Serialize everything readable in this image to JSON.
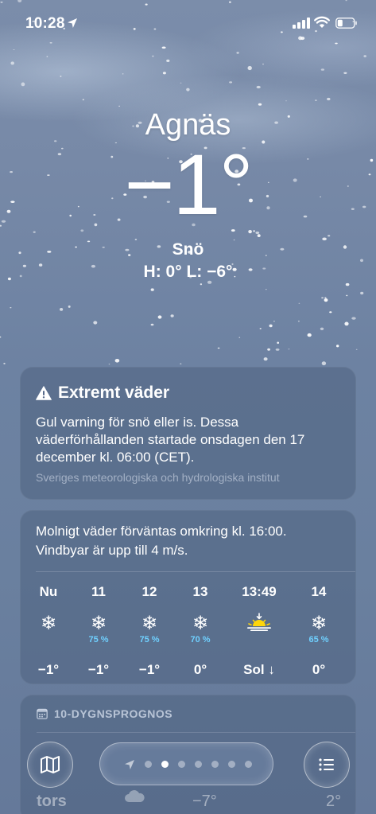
{
  "status_bar": {
    "time": "10:28",
    "icons": [
      "location-arrow-icon",
      "signal-icon",
      "wifi-icon",
      "battery-icon"
    ]
  },
  "header": {
    "city": "Agnäs",
    "temperature": "−1°",
    "condition": "Snö",
    "high_low": "H: 0°  L: −6°"
  },
  "alert": {
    "icon": "warning-icon",
    "title": "Extremt väder",
    "body": "Gul varning för snö eller is. Dessa väderförhållanden startade onsdagen den 17 december kl. 06:00 (CET).",
    "source": "Sveriges meteorologiska och hydrologiska institut"
  },
  "hourly": {
    "summary": "Molnigt väder förväntas omkring kl. 16:00. Vindbyar är upp till 4 m/s.",
    "hours": [
      {
        "label": "Nu",
        "icon": "snowflake-icon",
        "precip": "",
        "temp": "−1°"
      },
      {
        "label": "11",
        "icon": "snowflake-icon",
        "precip": "75 %",
        "temp": "−1°"
      },
      {
        "label": "12",
        "icon": "snowflake-icon",
        "precip": "75 %",
        "temp": "−1°"
      },
      {
        "label": "13",
        "icon": "snowflake-icon",
        "precip": "70 %",
        "temp": "0°"
      },
      {
        "label": "13:49",
        "icon": "sunset-icon",
        "precip": "",
        "temp": "Sol ↓"
      },
      {
        "label": "14",
        "icon": "snowflake-icon",
        "precip": "65 %",
        "temp": "0°"
      }
    ]
  },
  "ten_day": {
    "icon": "calendar-icon",
    "title": "10-DYGNSPROGNOS",
    "first_row": {
      "day": "tors",
      "low": "−7°",
      "high": "2°"
    }
  },
  "toolbar": {
    "map_icon": "map-icon",
    "list_icon": "list-icon",
    "page_count": 7,
    "active_page": 1
  },
  "colors": {
    "precip": "#6fd0ff",
    "sun": "#ffd60a"
  }
}
